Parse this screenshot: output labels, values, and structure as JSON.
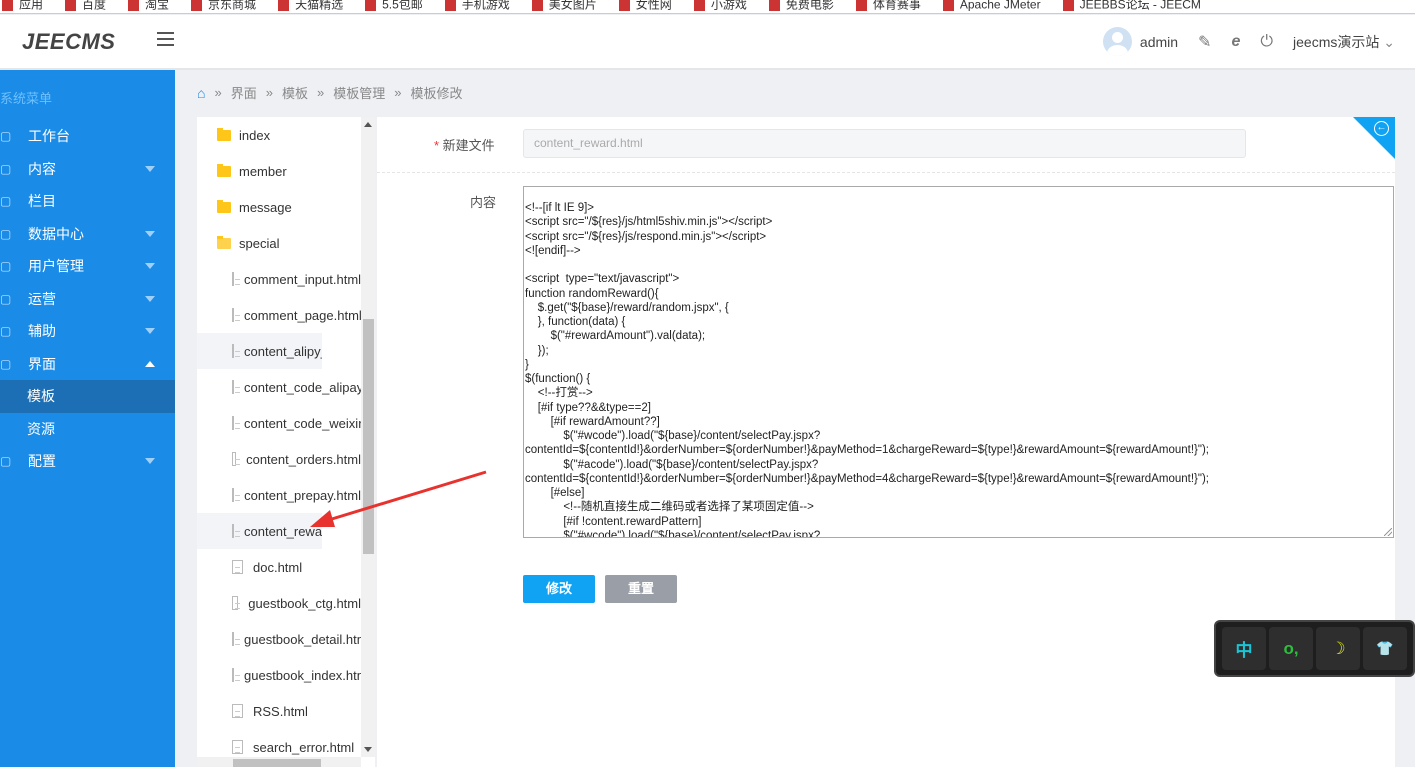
{
  "bookmarks": [
    "应用",
    "百度",
    "淘宝",
    "京东商城",
    "天猫精选",
    "5.5包邮",
    "手机游戏",
    "美女图片",
    "女性网",
    "小游戏",
    "免费电影",
    "体育赛事",
    "Apache JMeter",
    "JEEBBS论坛 - JEECM"
  ],
  "header": {
    "logo": "JEECMS",
    "user": "admin",
    "site": "jeecms演示站"
  },
  "sidebar": {
    "title": "系统菜单",
    "items": [
      {
        "label": "工作台",
        "icon": "monitor-icon"
      },
      {
        "label": "内容",
        "icon": "document-icon"
      },
      {
        "label": "栏目",
        "icon": "grid-icon"
      },
      {
        "label": "数据中心",
        "icon": "chart-icon"
      },
      {
        "label": "用户管理",
        "icon": "user-icon"
      },
      {
        "label": "运营",
        "icon": "circle-icon"
      },
      {
        "label": "辅助",
        "icon": "box-icon"
      },
      {
        "label": "界面",
        "icon": "layout-icon"
      },
      {
        "label": "模板"
      },
      {
        "label": "资源"
      },
      {
        "label": "配置",
        "icon": "gear-icon"
      }
    ]
  },
  "breadcrumb": [
    "界面",
    "模板",
    "模板管理",
    "模板修改"
  ],
  "tree": {
    "folders": [
      "index",
      "member",
      "message",
      "special"
    ],
    "files": [
      "comment_input.html",
      "comment_page.html",
      "content_alipy_mobile.html",
      "content_code_alipay.html",
      "content_code_weixin.html",
      "content_orders.html",
      "content_prepay.html",
      "content_reward.html",
      "doc.html",
      "guestbook_ctg.html",
      "guestbook_detail.html",
      "guestbook_index.html",
      "RSS.html",
      "search_error.html"
    ]
  },
  "form": {
    "filename_label": "新建文件",
    "filename_value": "content_reward.html",
    "content_label": "内容",
    "edit_button": "修改",
    "reset_button": "重置",
    "code": "<!--[if lt IE 9]>\n<script src=\"/${res}/js/html5shiv.min.js\"></script>\n<script src=\"/${res}/js/respond.min.js\"></script>\n<![endif]-->\n\n<script  type=\"text/javascript\">\nfunction randomReward(){\n\t$.get(\"${base}/reward/random.jspx\", {\n\t}, function(data) {\n\t\t$(\"#rewardAmount\").val(data);\n\t});\n}\n$(function() {\n\t<!--打赏-->\n\t[#if type??&&type==2]\n\t\t[#if rewardAmount??]\n\t\t\t$(\"#wcode\").load(\"${base}/content/selectPay.jspx?\ncontentId=${contentId!}&orderNumber=${orderNumber!}&payMethod=1&chargeReward=${type!}&rewardAmount=${rewardAmount!}\");\n\t\t\t$(\"#acode\").load(\"${base}/content/selectPay.jspx?\ncontentId=${contentId!}&orderNumber=${orderNumber!}&payMethod=4&chargeReward=${type!}&rewardAmount=${rewardAmount!}\");\n\t\t[#else]\n\t\t\t<!--随机直接生成二维码或者选择了某项固定值-->\n\t\t\t[#if !content.rewardPattern]\n\t\t\t$(\"#wcode\").load(\"${base}/content/selectPay.jspx?"
  },
  "ime": [
    "中",
    "o,",
    "☽",
    "👕"
  ],
  "colors": {
    "sidebar": "#1a8be6",
    "accent": "#10a3f3"
  }
}
